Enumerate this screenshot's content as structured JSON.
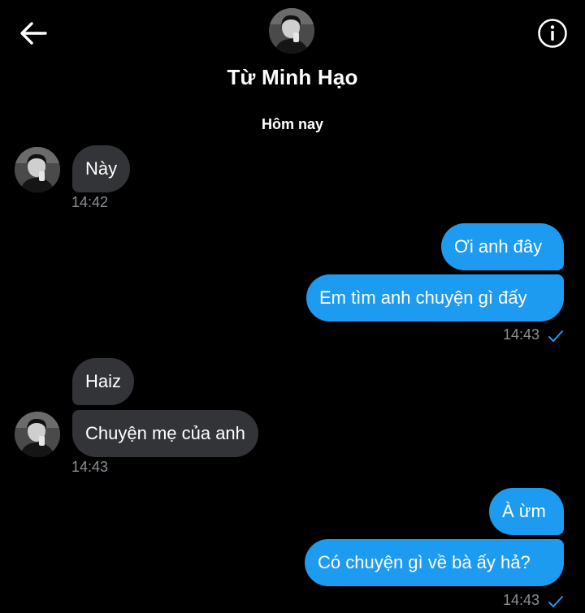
{
  "header": {
    "contact_name": "Từ Minh Hạo",
    "back_icon": "arrow-left-icon",
    "info_icon": "info-circle-icon"
  },
  "conversation": {
    "day_separator": "Hôm nay",
    "messages": [
      {
        "direction": "incoming",
        "text": "Này",
        "time": "14:42"
      },
      {
        "direction": "outgoing",
        "text": "Ơi anh đây"
      },
      {
        "direction": "outgoing",
        "text": "Em tìm anh chuyện gì đấy",
        "time": "14:43",
        "status": "sent"
      },
      {
        "direction": "incoming",
        "text": "Haiz"
      },
      {
        "direction": "incoming",
        "text": "Chuyện mẹ của anh",
        "time": "14:43"
      },
      {
        "direction": "outgoing",
        "text": "À ừm"
      },
      {
        "direction": "outgoing",
        "text": "Có chuyện gì về bà ấy hả?",
        "time": "14:43",
        "status": "sent"
      }
    ]
  },
  "colors": {
    "background": "#000000",
    "outgoing_bubble": "#1d9bf0",
    "incoming_bubble": "#333438",
    "timestamp": "#8b8f95",
    "check": "#1d9bf0"
  }
}
